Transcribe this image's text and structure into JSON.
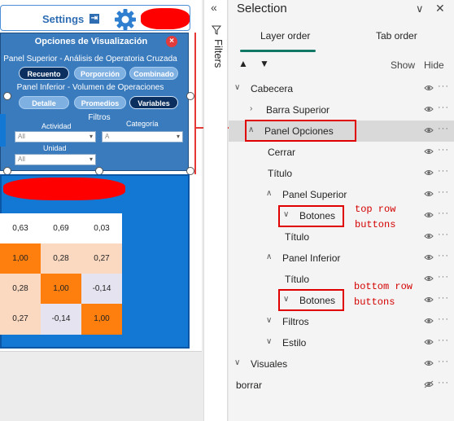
{
  "report": {
    "settings_label": "Settings",
    "settings_arrow": "⇥",
    "options_panel": {
      "title": "Opciones de Visualización",
      "close_glyph": "×",
      "top_section_title": "Panel Superior - Análisis de Operatoria Cruzada",
      "top_buttons": [
        "Recuento",
        "Porporción",
        "Combinado"
      ],
      "bottom_section_title": "Panel Inferior - Volumen de Operaciones",
      "bottom_buttons": [
        "Detalle",
        "Promedios",
        "Variables"
      ],
      "filters_title": "Filtros",
      "filter_actividad_label": "Actividad",
      "filter_actividad_value": "All",
      "filter_categoria_label": "Categoría",
      "filter_categoria_value": "A",
      "filter_unidad_label": "Unidad",
      "filter_unidad_value": "All"
    },
    "matrix": [
      [
        "0,63",
        "0,69",
        "0,03"
      ],
      [
        "1,00",
        "0,28",
        "0,27"
      ],
      [
        "0,28",
        "1,00",
        "-0,14"
      ],
      [
        "0,27",
        "-0,14",
        "1,00"
      ]
    ]
  },
  "filters_pane": {
    "label": "Filters",
    "collapse_icon": "«"
  },
  "selection_pane": {
    "title": "Selection",
    "tabs": [
      "Layer order",
      "Tab order"
    ],
    "show_label": "Show",
    "hide_label": "Hide",
    "layers": [
      {
        "label": "Cabecera",
        "chevron": "∨"
      },
      {
        "label": "Barra Superior",
        "chevron": "›"
      },
      {
        "label": "Panel Opciones",
        "chevron": "∧"
      },
      {
        "label": "Cerrar",
        "chevron": ""
      },
      {
        "label": "Título",
        "chevron": ""
      },
      {
        "label": "Panel Superior",
        "chevron": "∧"
      },
      {
        "label": "Botones",
        "chevron": "∨"
      },
      {
        "label": "Título",
        "chevron": ""
      },
      {
        "label": "Panel Inferior",
        "chevron": "∧"
      },
      {
        "label": "Título",
        "chevron": ""
      },
      {
        "label": "Botones",
        "chevron": "∨"
      },
      {
        "label": "Filtros",
        "chevron": "∨"
      },
      {
        "label": "Estilo",
        "chevron": "∨"
      },
      {
        "label": "Visuales",
        "chevron": "∨"
      },
      {
        "label": "borrar",
        "chevron": ""
      }
    ],
    "more_glyph": "···"
  },
  "annotations": {
    "top_row": "top row\nbuttons",
    "bottom_row": "bottom row\nbuttons"
  }
}
